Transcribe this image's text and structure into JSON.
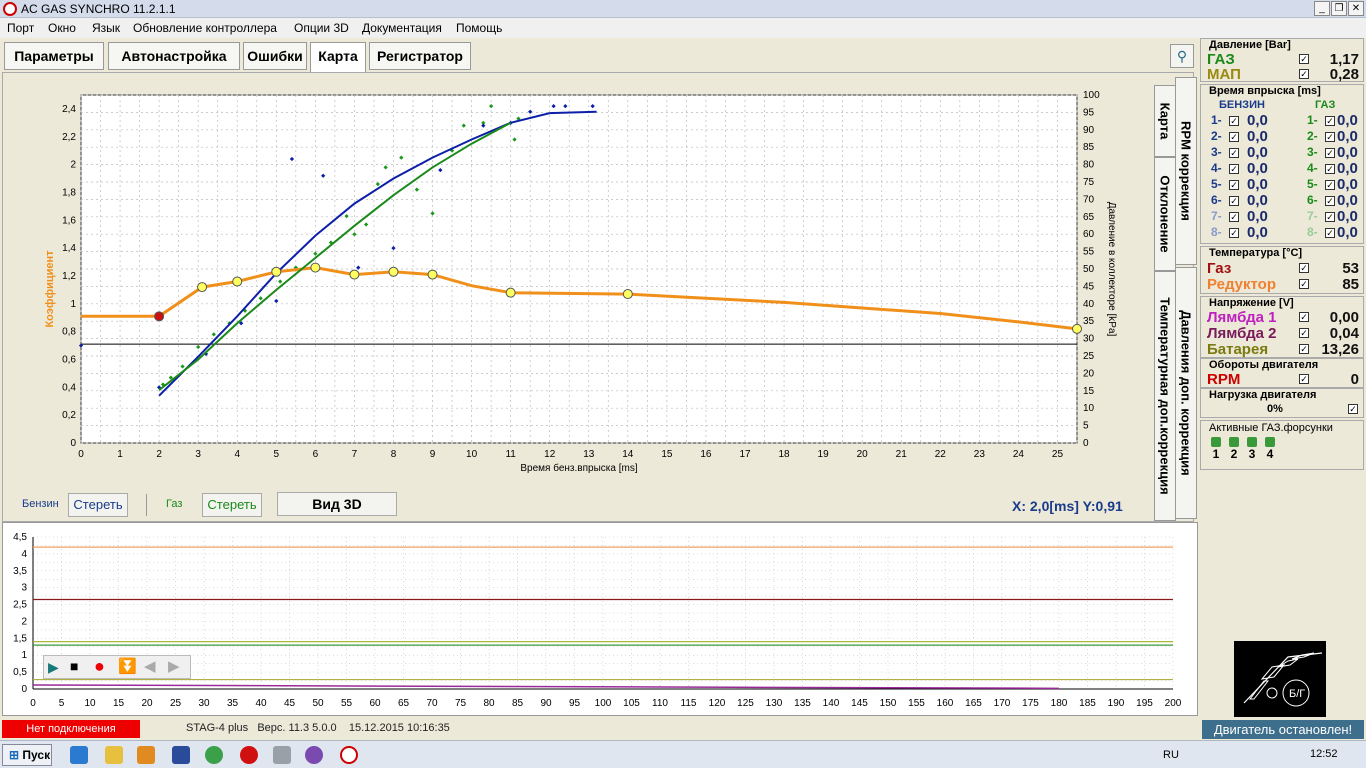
{
  "window": {
    "title": "AC GAS SYNCHRO  11.2.1.1"
  },
  "menu": [
    "Порт",
    "Окно",
    "Язык",
    "Обновление контроллера",
    "Опции 3D",
    "Документация",
    "Помощь"
  ],
  "tabs": [
    "Параметры",
    "Автонастройка",
    "Ошибки",
    "Карта",
    "Регистратор"
  ],
  "vtabs": [
    "Карта",
    "RPM коррекция",
    "Отклонение",
    "Давления доп. коррекция",
    "Температурная доп.коррекция"
  ],
  "chart": {
    "ylabel": "Коэффициент",
    "xlabel": "Время бенз.впрыска [ms]",
    "y2label": "Давление в коллекторе [kPa]"
  },
  "legend": {
    "petrol": "Бензин",
    "clear1": "Стереть",
    "gas": "Газ",
    "clear2": "Стереть",
    "view3d": "Вид 3D"
  },
  "readout": {
    "x": "X:",
    "xval": "2,0[ms]",
    "y": "Y:",
    "yval": "0,91"
  },
  "sidebar": {
    "pressure_title": "Давление [Bar]",
    "gas_label": "ГАЗ",
    "gas_val": "1,17",
    "map_label": "МАП",
    "map_val": "0,28",
    "inj_title": "Время впрыска [ms]",
    "petrol_hdr": "БЕНЗИН",
    "gas_hdr": "ГАЗ",
    "inj_rows": [
      "1-",
      "2-",
      "3-",
      "4-",
      "5-",
      "6-",
      "7-",
      "8-"
    ],
    "inj_val": "0,0",
    "temp_title": "Температура  [°C]",
    "temp_gas": "Газ",
    "temp_gas_val": "53",
    "temp_red": "Редуктор",
    "temp_red_val": "85",
    "volt_title": "Напряжение [V]",
    "l1": "Лямбда 1",
    "l1_val": "0,00",
    "l2": "Лямбда 2",
    "l2_val": "0,04",
    "bat": "Батарея",
    "bat_val": "13,26",
    "rpm_title": "Обороты двигателя",
    "rpm": "RPM",
    "rpm_val": "0",
    "load_title": "Нагрузка двигателя",
    "load_val": "0%",
    "active_title": "Активные ГАЗ.форсунки",
    "inj_nums": [
      "1",
      "2",
      "3",
      "4"
    ]
  },
  "status": {
    "connection": "Нет подключения",
    "device": "STAG-4 plus",
    "version": "Верс. 11.3  5.0.0",
    "datetime": "15.12.2015 10:16:35",
    "engine": "Двигатель остановлен!"
  },
  "taskbar": {
    "start": "Пуск",
    "lang": "RU",
    "clock": "12:52"
  },
  "colors": {
    "orange": "#f0901a",
    "blue": "#0d1fa8",
    "green": "#1a8a1a",
    "red": "#cc0000"
  },
  "chart_data": {
    "type": "line",
    "x_range": [
      0,
      25.5
    ],
    "y_range": [
      0,
      2.5
    ],
    "y2_range": [
      0,
      100
    ],
    "x_ticks": [
      0,
      1,
      2,
      3,
      4,
      5,
      6,
      7,
      8,
      9,
      10,
      11,
      12,
      13,
      14,
      15,
      16,
      17,
      18,
      19,
      20,
      21,
      22,
      23,
      24,
      25
    ],
    "y_ticks": [
      "0",
      "0,2",
      "0,4",
      "0,6",
      "0,8",
      "1",
      "1,2",
      "1,4",
      "1,6",
      "1,8",
      "2",
      "2,2",
      "2,4"
    ],
    "y2_ticks": [
      0,
      5,
      10,
      15,
      20,
      25,
      30,
      35,
      40,
      45,
      50,
      55,
      60,
      65,
      70,
      75,
      80,
      85,
      90,
      95,
      100
    ],
    "series": [
      {
        "name": "Коэффициент",
        "color": "#f0901a",
        "points": [
          [
            0,
            0.91
          ],
          [
            2,
            0.91
          ],
          [
            3.1,
            1.12
          ],
          [
            4,
            1.16
          ],
          [
            5,
            1.23
          ],
          [
            6,
            1.26
          ],
          [
            7,
            1.21
          ],
          [
            8,
            1.23
          ],
          [
            9,
            1.21
          ],
          [
            10,
            1.13
          ],
          [
            11,
            1.08
          ],
          [
            14,
            1.07
          ],
          [
            16,
            1.04
          ],
          [
            18,
            1.01
          ],
          [
            20,
            0.97
          ],
          [
            22,
            0.93
          ],
          [
            24,
            0.87
          ],
          [
            25.5,
            0.82
          ]
        ],
        "markers": [
          [
            3.1,
            1.12
          ],
          [
            4,
            1.16
          ],
          [
            5,
            1.23
          ],
          [
            6,
            1.26
          ],
          [
            7,
            1.21
          ],
          [
            8,
            1.23
          ],
          [
            9,
            1.21
          ],
          [
            11,
            1.08
          ],
          [
            14,
            1.07
          ],
          [
            25.5,
            0.82
          ]
        ],
        "red_marker": [
          2,
          0.91
        ]
      },
      {
        "name": "",
        "color": "#0d1fa8",
        "points": [
          [
            2,
            0.34
          ],
          [
            3,
            0.62
          ],
          [
            4,
            0.91
          ],
          [
            5,
            1.22
          ],
          [
            6,
            1.49
          ],
          [
            7,
            1.72
          ],
          [
            8,
            1.9
          ],
          [
            9,
            2.05
          ],
          [
            10,
            2.18
          ],
          [
            11,
            2.3
          ],
          [
            12,
            2.37
          ],
          [
            13.2,
            2.38
          ]
        ]
      },
      {
        "name": "",
        "color": "#1a8a1a",
        "points": [
          [
            2,
            0.38
          ],
          [
            3,
            0.6
          ],
          [
            4,
            0.86
          ],
          [
            5,
            1.1
          ],
          [
            6,
            1.33
          ],
          [
            7,
            1.56
          ],
          [
            8,
            1.78
          ],
          [
            9,
            1.98
          ],
          [
            10,
            2.15
          ],
          [
            11,
            2.3
          ]
        ]
      }
    ],
    "blue_dots": [
      [
        5.4,
        2.04
      ],
      [
        6.2,
        1.92
      ],
      [
        3.2,
        0.64
      ],
      [
        4.1,
        0.86
      ],
      [
        5.0,
        1.02
      ],
      [
        7.1,
        1.26
      ],
      [
        8.0,
        1.4
      ],
      [
        9.2,
        1.96
      ],
      [
        10.3,
        2.28
      ],
      [
        11.0,
        2.3
      ],
      [
        11.5,
        2.38
      ],
      [
        12.1,
        2.42
      ],
      [
        12.4,
        2.42
      ],
      [
        13.1,
        2.42
      ],
      [
        2.0,
        0.4
      ],
      [
        0,
        0.7
      ]
    ],
    "green_dots": [
      [
        2.1,
        0.42
      ],
      [
        2.3,
        0.47
      ],
      [
        2.6,
        0.55
      ],
      [
        3.0,
        0.69
      ],
      [
        3.4,
        0.78
      ],
      [
        3.8,
        0.86
      ],
      [
        4.2,
        0.95
      ],
      [
        4.6,
        1.04
      ],
      [
        5.1,
        1.16
      ],
      [
        5.5,
        1.26
      ],
      [
        6.0,
        1.36
      ],
      [
        6.4,
        1.44
      ],
      [
        6.8,
        1.63
      ],
      [
        7.0,
        1.5
      ],
      [
        7.3,
        1.57
      ],
      [
        7.6,
        1.86
      ],
      [
        7.8,
        1.98
      ],
      [
        8.2,
        2.05
      ],
      [
        8.6,
        1.82
      ],
      [
        9.0,
        1.65
      ],
      [
        9.5,
        2.1
      ],
      [
        9.8,
        2.28
      ],
      [
        10.3,
        2.3
      ],
      [
        10.5,
        2.42
      ],
      [
        11.1,
        2.18
      ],
      [
        11.2,
        2.33
      ]
    ],
    "black_line": 0.71
  },
  "lower_chart": {
    "x_ticks": [
      0,
      5,
      10,
      15,
      20,
      25,
      30,
      35,
      40,
      45,
      50,
      55,
      60,
      65,
      70,
      75,
      80,
      85,
      90,
      95,
      100,
      105,
      110,
      115,
      120,
      125,
      130,
      135,
      140,
      145,
      150,
      155,
      160,
      165,
      170,
      175,
      180,
      185,
      190,
      195,
      200
    ],
    "y_ticks": [
      "0",
      "0,5",
      "1",
      "1,5",
      "2",
      "2,5",
      "3",
      "3,5",
      "4",
      "4,5"
    ],
    "lines": [
      {
        "y": 4.2,
        "color": "#f0a060"
      },
      {
        "y": 2.65,
        "color": "#8b1a1a"
      },
      {
        "y": 1.4,
        "color": "#a0b020"
      },
      {
        "y": 1.3,
        "color": "#3a9a3a"
      },
      {
        "y": 0.28,
        "color": "#b0b040"
      }
    ]
  }
}
